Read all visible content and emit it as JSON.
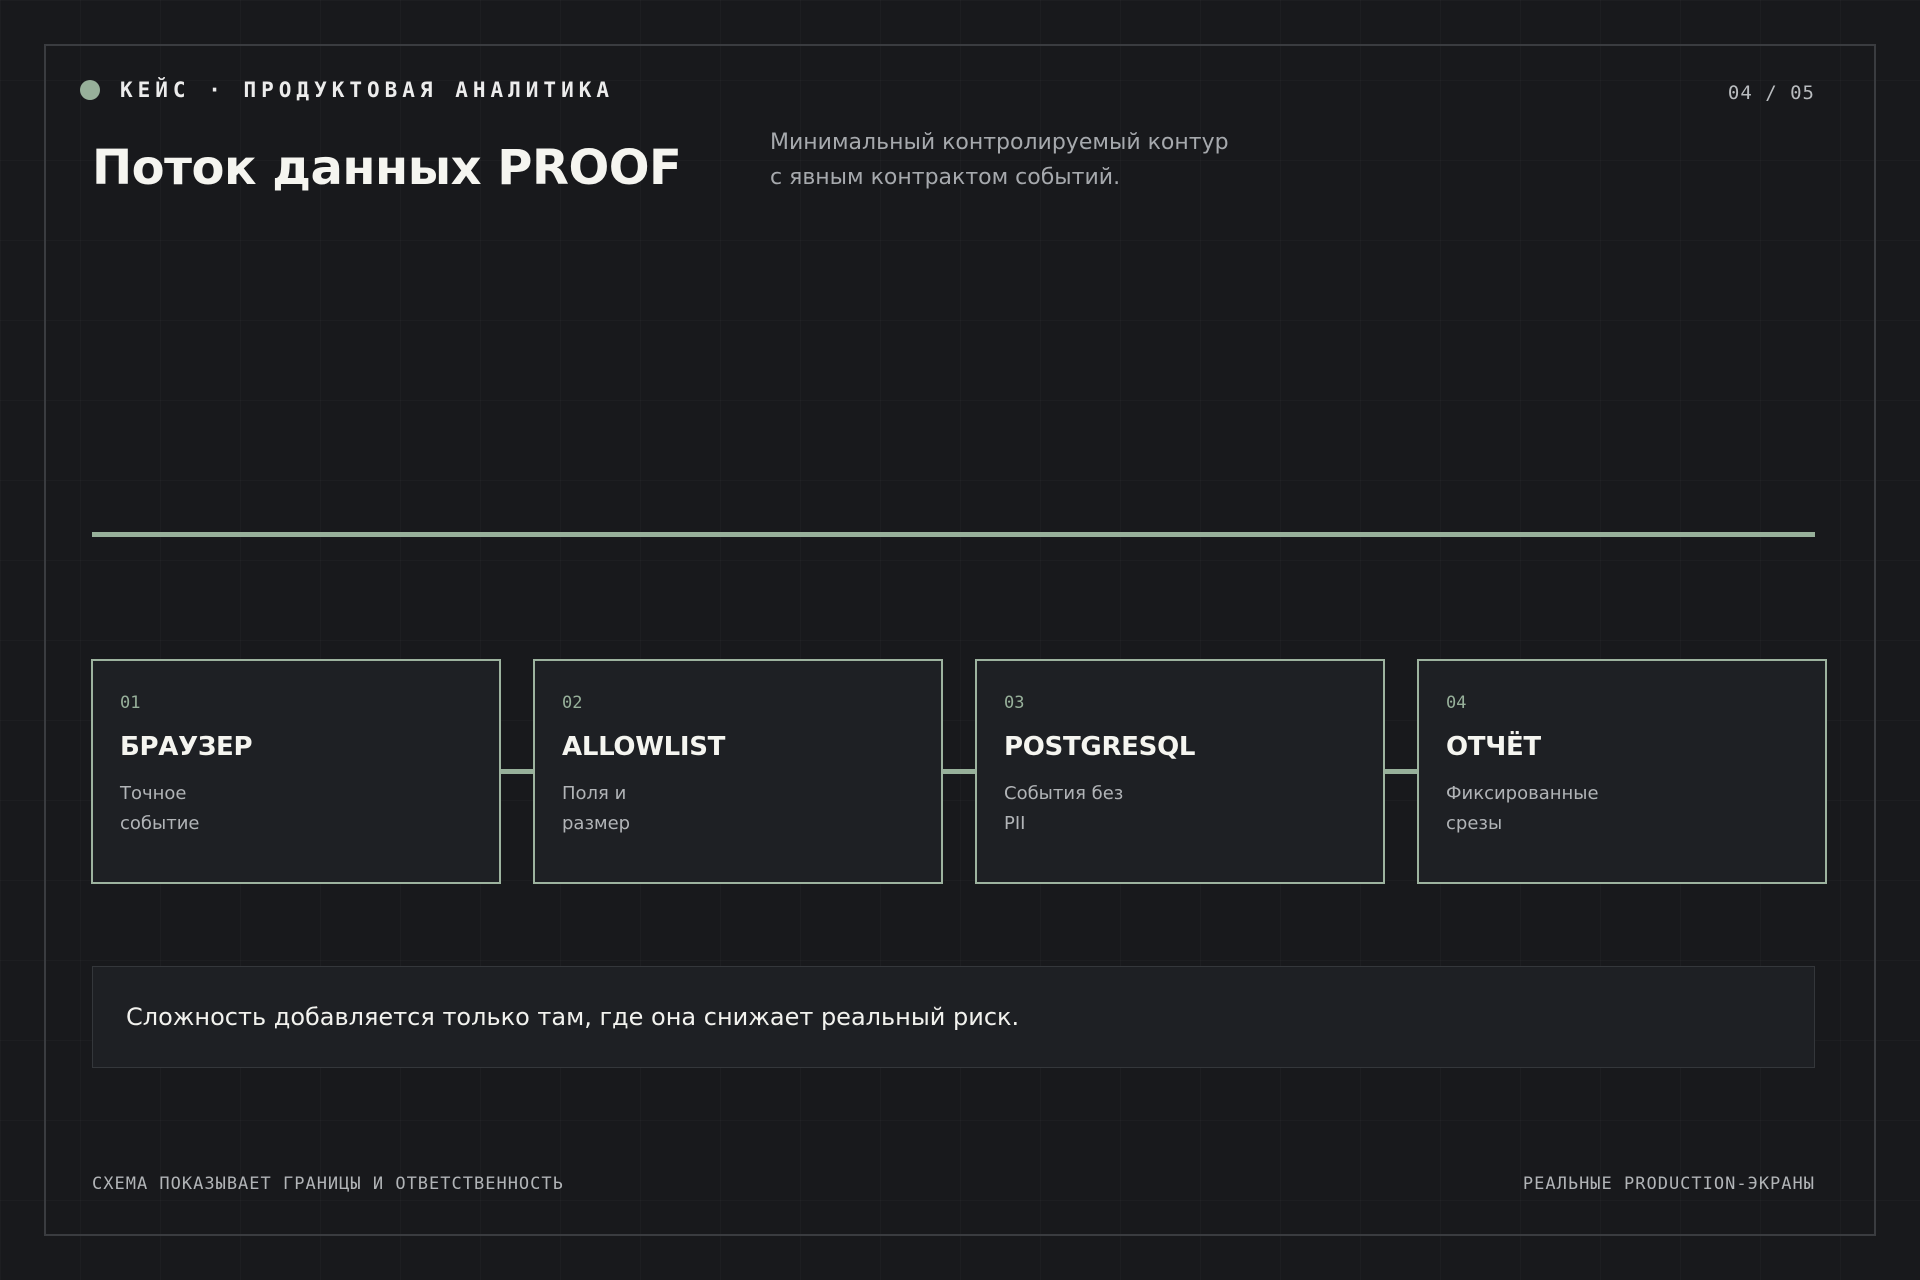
{
  "header": {
    "kicker": "КЕЙС · ПРОДУКТОВАЯ АНАЛИТИКА",
    "page": "04 / 05",
    "title": "Поток данных PROOF",
    "subtitle_lines": [
      "Минимальный контролируемый контур",
      "с явным контрактом событий."
    ]
  },
  "flow": {
    "steps": [
      {
        "num": "01",
        "title": "БРАУЗЕР",
        "desc_lines": [
          "Точное",
          "событие"
        ]
      },
      {
        "num": "02",
        "title": "ALLOWLIST",
        "desc_lines": [
          "Поля и",
          "размер"
        ]
      },
      {
        "num": "03",
        "title": "POSTGRESQL",
        "desc_lines": [
          "События без",
          "PII"
        ]
      },
      {
        "num": "04",
        "title": "ОТЧЁТ",
        "desc_lines": [
          "Фиксированные",
          "срезы"
        ]
      }
    ]
  },
  "callout": {
    "text": "Сложность добавляется только там, где она снижает реальный риск."
  },
  "footer": {
    "left": "СХЕМА ПОКАЗЫВАЕТ ГРАНИЦЫ И ОТВЕТСТВЕННОСТЬ",
    "right": "РЕАЛЬНЫЕ PRODUCTION-ЭКРАНЫ"
  },
  "colors": {
    "background": "#18191c",
    "accent": "#97b09a",
    "card": "#1e2024",
    "text": "#f5f5f0",
    "muted": "#a6a9ad"
  }
}
